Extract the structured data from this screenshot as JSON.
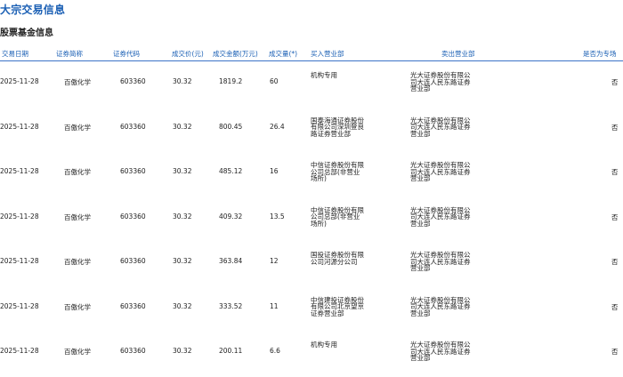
{
  "page": {
    "title": "大宗交易信息"
  },
  "section": {
    "title": "股票基金信息"
  },
  "columns": [
    "交易日期",
    "证券简称",
    "证券代码",
    "成交价(元)",
    "成交金额(万元)",
    "成交量(*)",
    "买入营业部",
    "卖出营业部",
    "是否为专场"
  ],
  "rows": [
    {
      "date": "2025-11-28",
      "name": "百傲化学",
      "code": "603360",
      "price": "30.32",
      "amount": "1819.2",
      "volume": "60",
      "buyer": "机构专用",
      "seller": "光大证券股份有限公司大连人民东路证券营业部",
      "special": "否"
    },
    {
      "date": "2025-11-28",
      "name": "百傲化学",
      "code": "603360",
      "price": "30.32",
      "amount": "800.45",
      "volume": "26.4",
      "buyer": "国泰海通证券股份有限公司深圳登良路证券营业部",
      "seller": "光大证券股份有限公司大连人民东路证券营业部",
      "special": "否"
    },
    {
      "date": "2025-11-28",
      "name": "百傲化学",
      "code": "603360",
      "price": "30.32",
      "amount": "485.12",
      "volume": "16",
      "buyer": "中信证券股份有限公司总部(非营业场所)",
      "seller": "光大证券股份有限公司大连人民东路证券营业部",
      "special": "否"
    },
    {
      "date": "2025-11-28",
      "name": "百傲化学",
      "code": "603360",
      "price": "30.32",
      "amount": "409.32",
      "volume": "13.5",
      "buyer": "中信证券股份有限公司总部(非营业场所)",
      "seller": "光大证券股份有限公司大连人民东路证券营业部",
      "special": "否"
    },
    {
      "date": "2025-11-28",
      "name": "百傲化学",
      "code": "603360",
      "price": "30.32",
      "amount": "363.84",
      "volume": "12",
      "buyer": "国投证券股份有限公司河源分公司",
      "seller": "光大证券股份有限公司大连人民东路证券营业部",
      "special": "否"
    },
    {
      "date": "2025-11-28",
      "name": "百傲化学",
      "code": "603360",
      "price": "30.32",
      "amount": "333.52",
      "volume": "11",
      "buyer": "中信建投证券股份有限公司北京望京证券营业部",
      "seller": "光大证券股份有限公司大连人民东路证券营业部",
      "special": "否"
    },
    {
      "date": "2025-11-28",
      "name": "百傲化学",
      "code": "603360",
      "price": "30.32",
      "amount": "200.11",
      "volume": "6.6",
      "buyer": "机构专用",
      "seller": "光大证券股份有限公司大连人民东路证券营业部",
      "special": "否"
    }
  ]
}
